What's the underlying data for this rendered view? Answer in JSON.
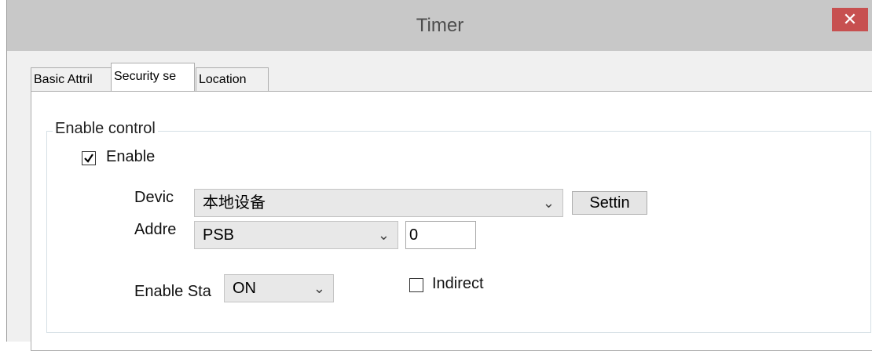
{
  "window": {
    "title": "Timer",
    "close_label": "✕"
  },
  "tabs": [
    {
      "label": "Basic Attril",
      "active": false
    },
    {
      "label": "Security se",
      "active": true
    },
    {
      "label": "Location",
      "active": false
    }
  ],
  "group": {
    "title": "Enable control"
  },
  "enable_checkbox": {
    "label": "Enable",
    "checked": true
  },
  "device": {
    "label": "Devic",
    "value": "本地设备",
    "settings_label": "Settin"
  },
  "address": {
    "label": "Addre",
    "type_value": "PSB",
    "number_value": "0"
  },
  "enable_state": {
    "label": "Enable Sta",
    "value": "ON"
  },
  "indirect_checkbox": {
    "label": "Indirect",
    "checked": false
  },
  "icons": {
    "dropdown": "chevron-down-icon",
    "check": "checkmark-icon",
    "close": "close-icon"
  }
}
